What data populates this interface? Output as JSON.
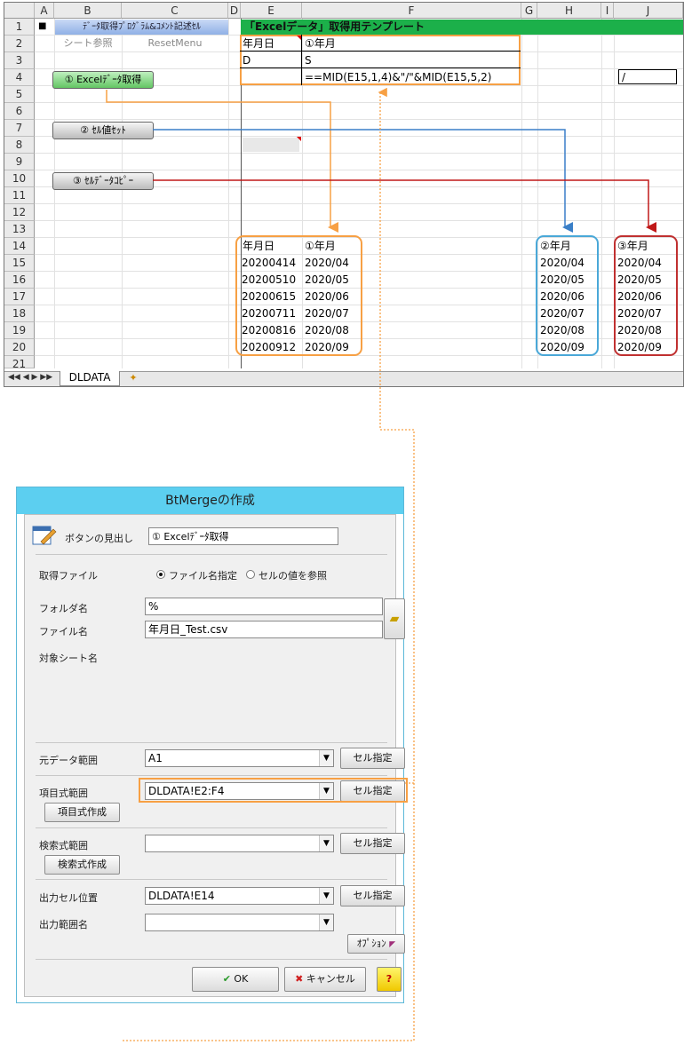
{
  "sheet": {
    "columns": [
      "A",
      "B",
      "C",
      "D",
      "E",
      "F",
      "G",
      "H",
      "I",
      "J"
    ],
    "rows": [
      "1",
      "2",
      "3",
      "4",
      "5",
      "6",
      "7",
      "8",
      "9",
      "10",
      "11",
      "12",
      "13",
      "14",
      "15",
      "16",
      "17",
      "18",
      "19",
      "20",
      "21"
    ],
    "row1": {
      "marker": "■",
      "blue_label": "ﾃﾞｰﾀ取得ﾌﾟﾛｸﾞﾗﾑ&ｺﾒﾝﾄ記述ｾﾙ",
      "green_label": "「Excelデータ」取得用テンプレート"
    },
    "row2": {
      "sheet_ref": "シート参照",
      "reset_menu": "ResetMenu"
    },
    "template": {
      "e2": "年月日",
      "f2": "①年月",
      "e3": "D",
      "f3": "S",
      "f4": "==MID(E15,1,4)&\"/\"&MID(E15,5,2)",
      "j4": "/"
    },
    "buttons": {
      "excel_get": "① Excelﾃﾞｰﾀ取得",
      "cell_set": "② ｾﾙ値ｾｯﾄ",
      "cell_copy": "③ ｾﾙﾃﾞｰﾀｺﾋﾟｰ"
    },
    "result_headers": {
      "e14": "年月日",
      "f14": "①年月",
      "h14": "②年月",
      "j14": "③年月"
    },
    "dates": [
      "20200414",
      "20200510",
      "20200615",
      "20200711",
      "20200816",
      "20200912"
    ],
    "months": [
      "2020/04",
      "2020/05",
      "2020/06",
      "2020/07",
      "2020/08",
      "2020/09"
    ],
    "tab_name": "DLDATA"
  },
  "dialog": {
    "title": "BtMergeの作成",
    "caption_label": "ボタンの見出し",
    "caption_value": "① Excelﾃﾞｰﾀ取得",
    "source_file_label": "取得ファイル",
    "radio_filename": "ファイル名指定",
    "radio_cellvalue": "セルの値を参照",
    "folder_label": "フォルダ名",
    "folder_value": "%",
    "file_label": "ファイル名",
    "file_value": "年月日_Test.csv",
    "target_sheet_label": "対象シート名",
    "src_range_label": "元データ範囲",
    "src_range_value": "A1",
    "item_range_label": "項目式範囲",
    "item_range_value": "DLDATA!E2:F4",
    "item_create": "項目式作成",
    "search_range_label": "検索式範囲",
    "search_range_value": "",
    "search_create": "検索式作成",
    "out_cell_label": "出力セル位置",
    "out_cell_value": "DLDATA!E14",
    "out_name_label": "出力範囲名",
    "out_name_value": "",
    "cell_select": "セル指定",
    "option": "ｵﾌﾟｼｮﾝ",
    "ok": "OK",
    "cancel": "キャンセル",
    "help": "?"
  },
  "colors": {
    "orange": "#f7a044",
    "blue": "#3a7fc8",
    "red": "#c01818",
    "green_bar": "#1cb04a",
    "teal": "#5ccff0"
  }
}
